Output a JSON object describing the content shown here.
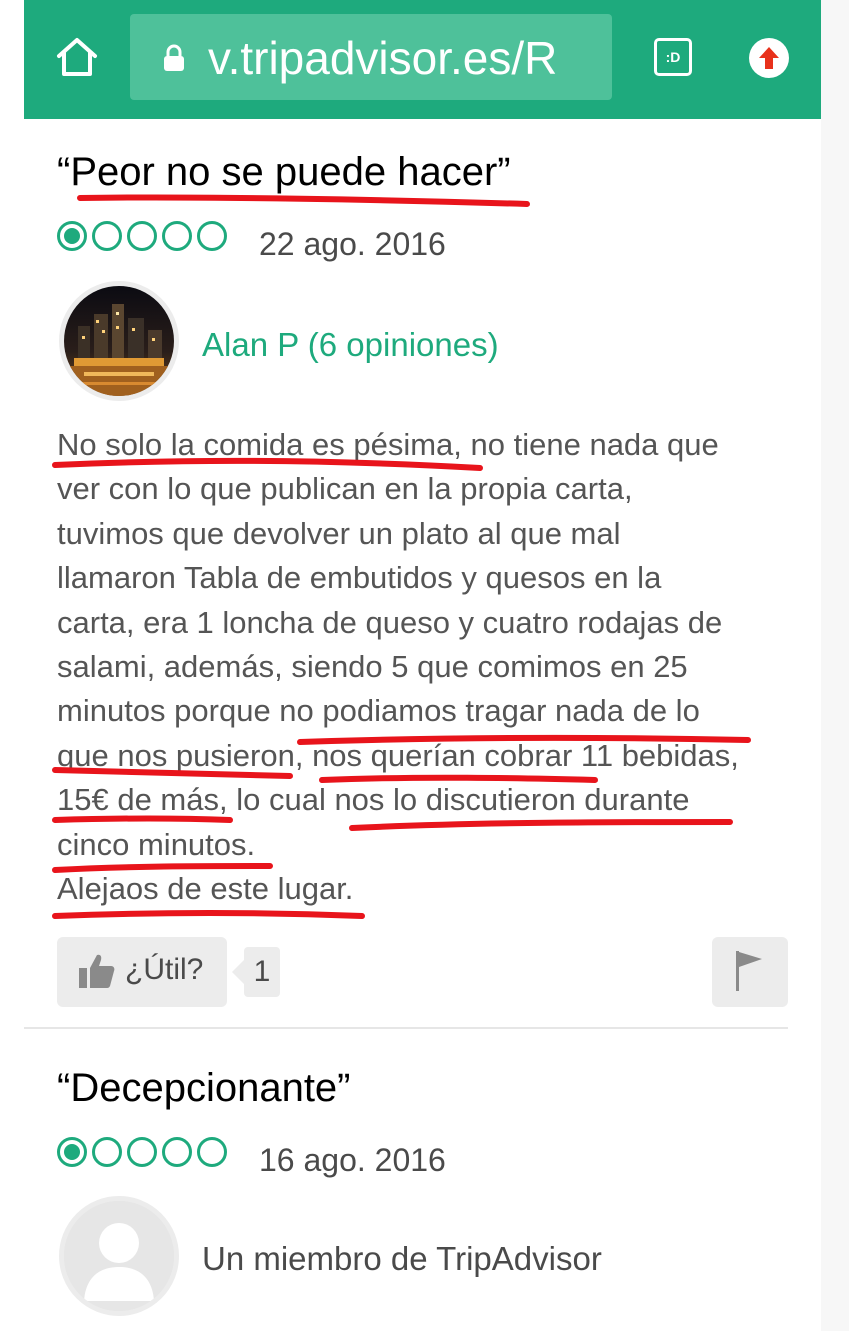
{
  "browser": {
    "url": "v.tripadvisor.es/R",
    "tabs_label": ":D"
  },
  "reviews": [
    {
      "title": "“Peor no se puede hacer”",
      "rating": 1,
      "max_rating": 5,
      "date": "22 ago. 2016",
      "reviewer": "Alan P (6 opiniones)",
      "body_lines": [
        "No solo la comida es pésima, no tiene nada que",
        "ver con lo que publican en la propia carta,",
        "tuvimos que devolver un plato al que mal",
        "llamaron Tabla de embutidos y quesos en la",
        "carta, era 1 loncha de queso y cuatro rodajas de",
        "salami, además, siendo 5 que comimos en 25",
        "minutos porque no podiamos tragar nada de lo",
        "que nos pusieron, nos querían cobrar 11 bebidas,",
        "15€ de más, lo cual nos lo discutieron durante",
        "cinco minutos.",
        "Alejaos de este lugar."
      ],
      "helpful_label": "¿Útil?",
      "helpful_count": "1"
    },
    {
      "title": "“Decepcionante”",
      "rating": 1,
      "max_rating": 5,
      "date": "16 ago. 2016",
      "reviewer": "Un miembro de TripAdvisor"
    }
  ],
  "colors": {
    "brand_green": "#1eaa7d",
    "url_box": "#4ec19a",
    "annotation_red": "#e8141b",
    "body_text": "#555555"
  },
  "icons": [
    "home-icon",
    "lock-icon",
    "tabs-icon",
    "opera-update-icon",
    "rating-bubble-icon",
    "thumbs-up-icon",
    "flag-icon",
    "avatar-placeholder-icon"
  ]
}
